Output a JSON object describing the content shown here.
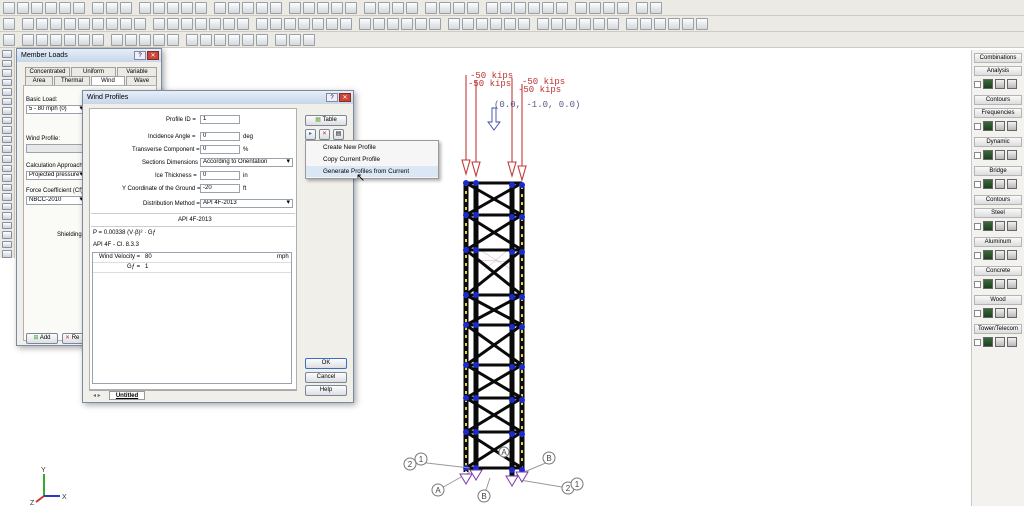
{
  "member_loads": {
    "title": "Member Loads",
    "help": "?",
    "tabs_top": [
      "Concentrated",
      "Uniform",
      "Variable"
    ],
    "tabs_bottom": [
      "Area",
      "Thermal",
      "Wind",
      "Wave"
    ],
    "basic_load_label": "Basic Load:",
    "basic_load_value": "5 - 80 mph (0)",
    "wind_profile_label": "Wind Profile:",
    "calc_approach_label": "Calculation Approach:",
    "calc_approach_value": "Projected pressure",
    "force_coef_label": "Force Coefficient (Cf):",
    "force_coef_value": "NBCC-2010",
    "shielding_label": "Shielding",
    "add_label": "Add",
    "remove_label": "Re"
  },
  "wind_profiles": {
    "title": "Wind Profiles",
    "help": "?",
    "profile_id": {
      "label": "Profile ID =",
      "value": "1"
    },
    "incidence": {
      "label": "Incidence Angle =",
      "value": "0",
      "unit": "deg"
    },
    "transverse": {
      "label": "Transverse Component =",
      "value": "0",
      "unit": "%"
    },
    "sections": {
      "label": "Sections Dimensions =",
      "value": "According to Orientation"
    },
    "ice": {
      "label": "Ice Thickness =",
      "value": "0",
      "unit": "in"
    },
    "ycoord": {
      "label": "Y Coordinate of the Ground =",
      "value": "-20",
      "unit": "ft"
    },
    "dist": {
      "label": "Distribution Method =",
      "value": "API 4F-2013"
    },
    "section_header": "API 4F-2013",
    "formula": "P = 0.00338 (V·β)² · Gƒ",
    "clause": "API 4F - Cl. 8.3.3",
    "grid": [
      {
        "name": "Wind Velocity =",
        "value": "80",
        "unit": "mph"
      },
      {
        "name": "Gƒ =",
        "value": "1",
        "unit": ""
      }
    ],
    "table_btn": "Table",
    "ok": "OK",
    "cancel": "Cancel",
    "help_btn": "Help",
    "sheet_tab": "Untitled"
  },
  "context_menu": [
    "Create New Profile",
    "Copy Current Profile",
    "Generate Profiles from Current"
  ],
  "model": {
    "load1": "-50 kips",
    "load2": "-50 kips",
    "load3": "-50 kips",
    "load4": "-50 kips",
    "vector": "(0.0, -1.0, 0.0)",
    "grid_a": "A",
    "grid_b": "B",
    "grid_1": "1",
    "grid_2": "2",
    "axis_x": "X",
    "axis_y": "Y",
    "axis_z": "Z"
  },
  "right_panel": {
    "header": "Combinations",
    "sections": [
      {
        "label": "Analysis",
        "rows": 1
      },
      {
        "label": "Contours",
        "rows": 0
      },
      {
        "label": "Frequencies",
        "rows": 1
      },
      {
        "label": "Dynamic",
        "rows": 1
      },
      {
        "label": "Bridge",
        "rows": 1
      },
      {
        "label": "Contours",
        "rows": 0
      },
      {
        "label": "Steel",
        "rows": 1
      },
      {
        "label": "Aluminum",
        "rows": 1
      },
      {
        "label": "Concrete",
        "rows": 1
      },
      {
        "label": "Wood",
        "rows": 1
      },
      {
        "label": "Tower/Telecom",
        "rows": 1
      }
    ]
  }
}
